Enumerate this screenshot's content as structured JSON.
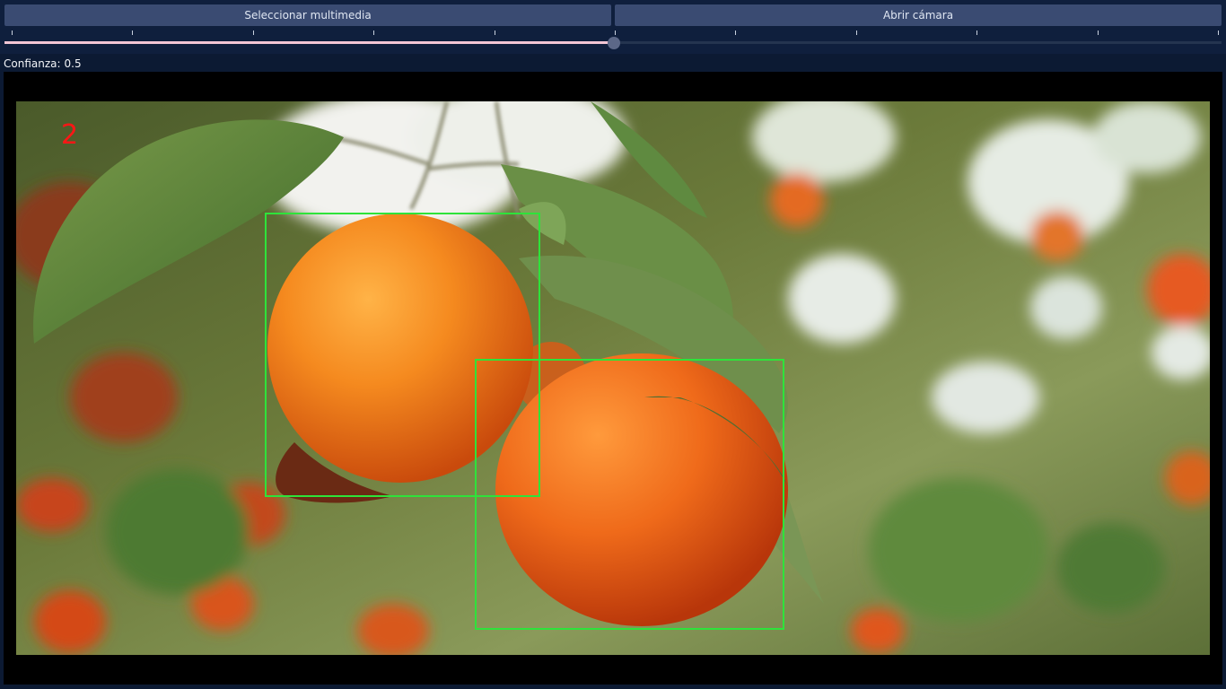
{
  "toolbar": {
    "select_media_label": "Seleccionar multimedia",
    "open_camera_label": "Abrir cámara"
  },
  "confidence": {
    "label": "Confianza:",
    "value": "0.5",
    "slider_fraction": 0.5,
    "tick_count": 11
  },
  "detection": {
    "count": "2",
    "box_color": "#2ee33a",
    "count_color": "#ff1616"
  },
  "colors": {
    "background": "#0c1a33",
    "button": "#3a4b72",
    "slider_fill": "#f3c6d5"
  }
}
